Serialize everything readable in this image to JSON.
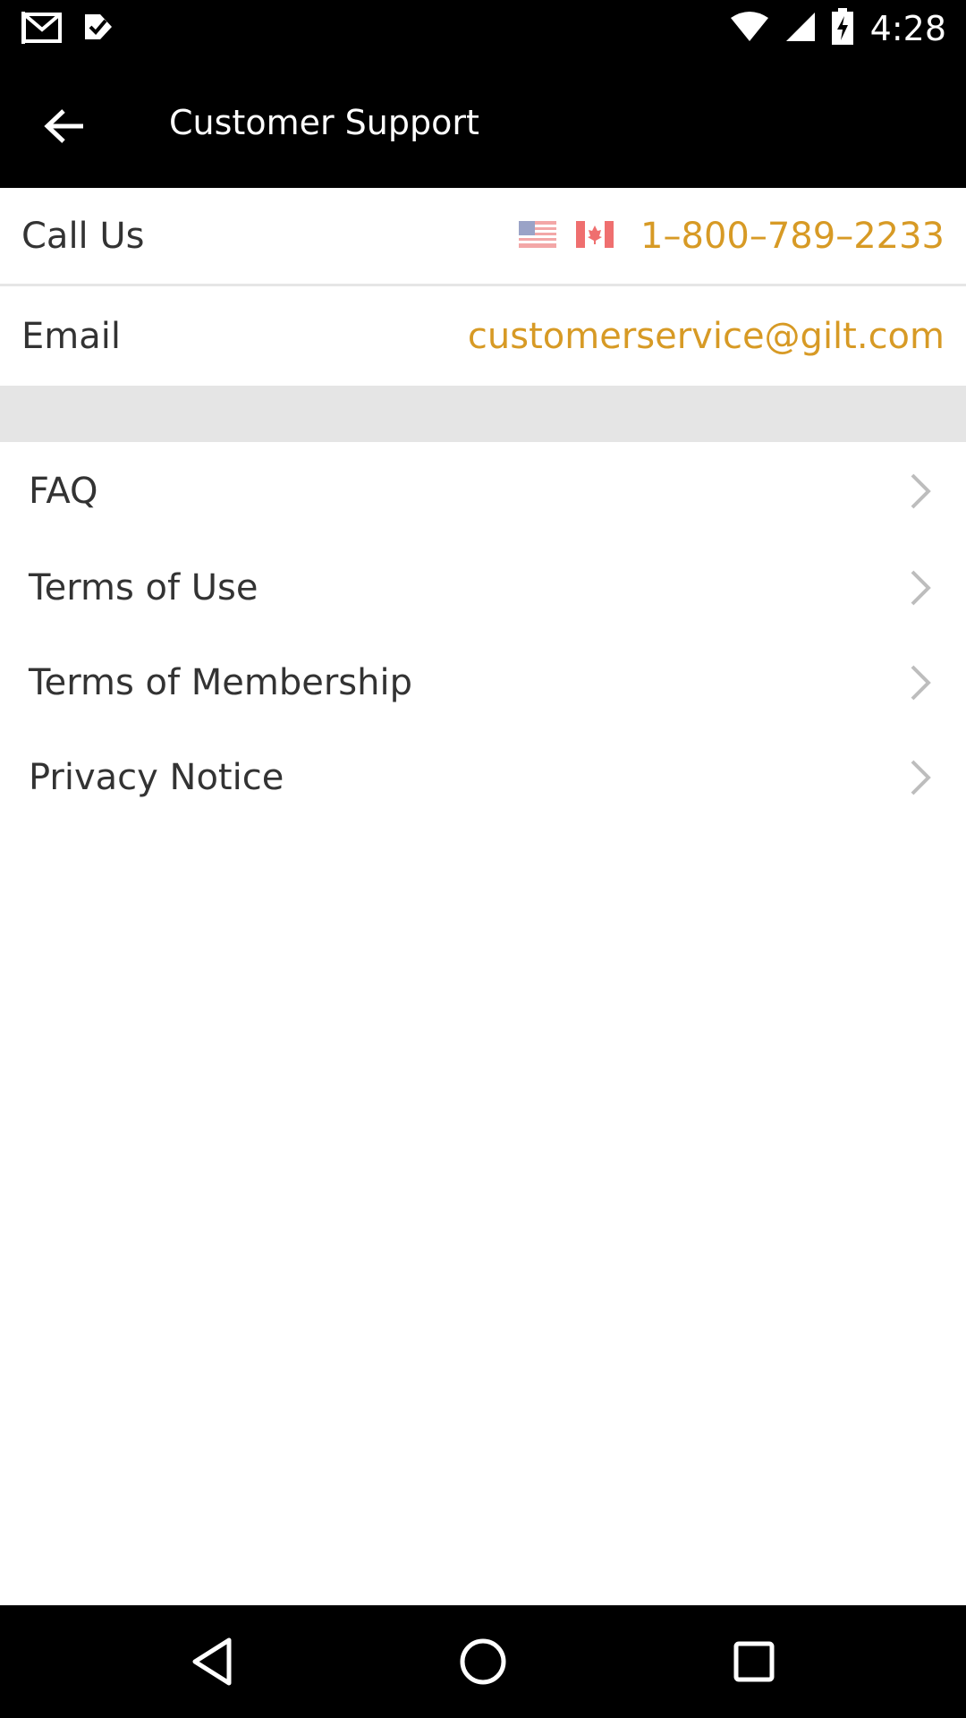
{
  "status_bar": {
    "time": "4:28",
    "left_icons": [
      "gmail-icon",
      "inbox-check-icon"
    ],
    "right_icons": [
      "wifi-icon",
      "signal-icon",
      "battery-charging-icon"
    ]
  },
  "app_bar": {
    "title": "Customer Support",
    "back_icon": "arrow-back-icon"
  },
  "contact": {
    "call": {
      "label": "Call Us",
      "flags": [
        "us-flag-icon",
        "canada-flag-icon"
      ],
      "value": "1–800–789–2233"
    },
    "email": {
      "label": "Email",
      "value": "customerservice@gilt.com"
    }
  },
  "menu": {
    "items": [
      {
        "label": "FAQ"
      },
      {
        "label": "Terms of Use"
      },
      {
        "label": "Terms of Membership"
      },
      {
        "label": "Privacy Notice"
      }
    ]
  },
  "nav_bar": {
    "icons": [
      "nav-back-icon",
      "nav-home-icon",
      "nav-recents-icon"
    ]
  },
  "colors": {
    "accent": "#d79a25",
    "text": "#333333",
    "bar_bg": "#000000",
    "divider": "#e5e5e5",
    "chevron": "#bdbdbd"
  }
}
